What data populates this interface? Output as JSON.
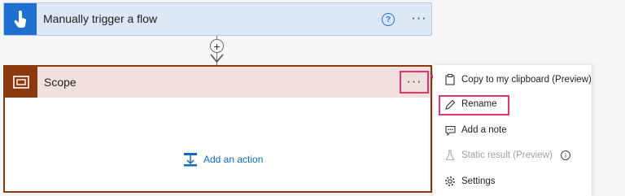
{
  "trigger": {
    "title": "Manually trigger a flow",
    "help_glyph": "?",
    "more_glyph": "···",
    "icon": "hand-touch-icon"
  },
  "connector": {
    "add_glyph": "+"
  },
  "scope": {
    "title": "Scope",
    "more_glyph": "···",
    "icon": "scope-icon",
    "add_action_label": "Add an action",
    "color": "#8b3a10"
  },
  "menu": {
    "items": [
      {
        "label": "Copy to my clipboard (Preview)",
        "icon": "clipboard-icon",
        "enabled": true
      },
      {
        "label": "Rename",
        "icon": "pencil-icon",
        "enabled": true
      },
      {
        "label": "Add a note",
        "icon": "note-icon",
        "enabled": true
      },
      {
        "label": "Static result (Preview)",
        "icon": "flask-icon",
        "enabled": false
      },
      {
        "label": "Settings",
        "icon": "gear-icon",
        "enabled": true
      }
    ],
    "info_glyph": "i"
  },
  "highlight_color": "#e63470"
}
